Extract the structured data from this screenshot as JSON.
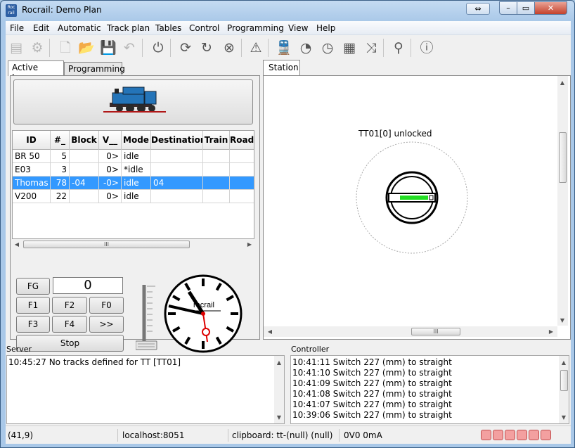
{
  "window": {
    "title": "Rocrail: Demo Plan",
    "app_icon": "rocrail-icon",
    "app_icon_text_top": "Roc",
    "app_icon_text_bottom": "rail",
    "expand_glyph": "⇔",
    "minimize_glyph": "–",
    "maximize_glyph": "▭",
    "close_glyph": "✕"
  },
  "menu": [
    "File",
    "Edit",
    "Automatic",
    "Track plan",
    "Tables",
    "Control",
    "Programming",
    "View",
    "Help"
  ],
  "toolbar": {
    "icons": [
      {
        "name": "server-icon",
        "glyph": "▤",
        "enabled": false
      },
      {
        "name": "settings-icon",
        "glyph": "⚙",
        "enabled": false
      },
      {
        "name": "new-file-icon",
        "glyph": "🗋",
        "enabled": false
      },
      {
        "name": "open-folder-icon",
        "glyph": "📂",
        "enabled": false
      },
      {
        "name": "save-icon",
        "glyph": "💾",
        "enabled": true
      },
      {
        "name": "undo-icon",
        "glyph": "↶",
        "enabled": false
      },
      {
        "name": "power-icon",
        "glyph": "⏻",
        "enabled": true
      },
      {
        "name": "refresh-icon",
        "glyph": "⟳",
        "enabled": true
      },
      {
        "name": "reset-icon",
        "glyph": "↻",
        "enabled": true
      },
      {
        "name": "cancel-icon",
        "glyph": "⊗",
        "enabled": true
      },
      {
        "name": "warning-icon",
        "glyph": "⚠",
        "enabled": true
      },
      {
        "name": "train-icon",
        "glyph": "🚆",
        "enabled": true
      },
      {
        "name": "throttle-icon",
        "glyph": "◔",
        "enabled": true
      },
      {
        "name": "speedometer-icon",
        "glyph": "◷",
        "enabled": true
      },
      {
        "name": "grid-icon",
        "glyph": "▦",
        "enabled": true
      },
      {
        "name": "shuffle-icon",
        "glyph": "⤨",
        "enabled": true
      },
      {
        "name": "zoom-icon",
        "glyph": "⚲",
        "enabled": true
      },
      {
        "name": "info-icon",
        "glyph": "ⓘ",
        "enabled": true
      }
    ]
  },
  "left_tabs": {
    "active": "Active Locos",
    "other": "Programming"
  },
  "locos": {
    "columns": [
      "ID",
      "#_",
      "Block",
      "V__",
      "Mode",
      "Destination",
      "Train",
      "Roadn"
    ],
    "rows": [
      {
        "id": "BR 50",
        "addr": "5",
        "block": "",
        "v": "0>",
        "mode": "idle",
        "dest": "",
        "train": "",
        "road": "",
        "selected": false
      },
      {
        "id": "E03",
        "addr": "3",
        "block": "",
        "v": "0>",
        "mode": "*idle",
        "dest": "",
        "train": "",
        "road": "",
        "selected": false
      },
      {
        "id": "Thomas",
        "addr": "78",
        "block": "-04",
        "v": "-0>",
        "mode": "idle",
        "dest": "04",
        "train": "",
        "road": "",
        "selected": true
      },
      {
        "id": "V200",
        "addr": "22",
        "block": "",
        "v": "0>",
        "mode": "idle",
        "dest": "",
        "train": "",
        "road": "",
        "selected": false
      }
    ],
    "scroll_grip": "III"
  },
  "throttle": {
    "fg": "FG",
    "speed": "0",
    "f1": "F1",
    "f2": "F2",
    "f0": "F0",
    "f3": "F3",
    "f4": "F4",
    "more": ">>",
    "stop": "Stop"
  },
  "clock": {
    "brand": "rocrail"
  },
  "station": {
    "tab": "Station",
    "turntable_label": "TT01[0] unlocked",
    "scroll_grip": "III"
  },
  "server": {
    "label": "Server",
    "lines": [
      "10:45:27 No tracks defined for TT [TT01]"
    ]
  },
  "controller": {
    "label": "Controller",
    "lines": [
      "10:41:11 Switch 227 (mm) to straight",
      "10:41:10 Switch 227 (mm) to straight",
      "10:41:09 Switch 227 (mm) to straight",
      "10:41:08 Switch 227 (mm) to straight",
      "10:41:07 Switch 227 (mm) to straight",
      "10:39:06 Switch 227 (mm) to straight"
    ]
  },
  "status": {
    "coords": "(41,9)",
    "host": "localhost:8051",
    "clipboard": "clipboard: tt-(null) (null)",
    "power": "0V0 0mA"
  },
  "colors": {
    "selection": "#3399ff",
    "turntable_bridge": "#22dd22",
    "led": "#f3a0a0"
  }
}
